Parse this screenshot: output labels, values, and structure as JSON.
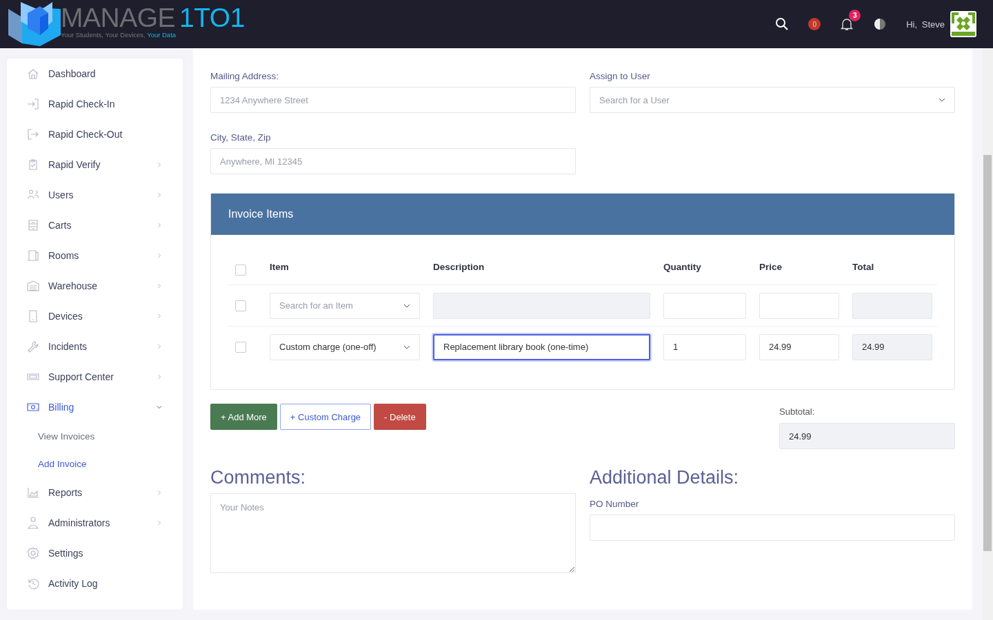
{
  "header": {
    "logo_title": [
      "MANAGE",
      "1TO1"
    ],
    "logo_tagline": [
      "Your Students, Your Devices,",
      "Your Data"
    ],
    "cart_count": "0",
    "notification_count": "3",
    "greeting": "Hi,",
    "user_name": "Steve"
  },
  "sidebar": {
    "items": [
      {
        "label": "Dashboard",
        "has_submenu": false,
        "selected": false
      },
      {
        "label": "Rapid Check-In",
        "has_submenu": false,
        "selected": false
      },
      {
        "label": "Rapid Check-Out",
        "has_submenu": false,
        "selected": false
      },
      {
        "label": "Rapid Verify",
        "has_submenu": true,
        "selected": false,
        "expanded": false
      },
      {
        "label": "Users",
        "has_submenu": true,
        "selected": false,
        "expanded": false
      },
      {
        "label": "Carts",
        "has_submenu": true,
        "selected": false,
        "expanded": false
      },
      {
        "label": "Rooms",
        "has_submenu": true,
        "selected": false,
        "expanded": false
      },
      {
        "label": "Warehouse",
        "has_submenu": true,
        "selected": false,
        "expanded": false
      },
      {
        "label": "Devices",
        "has_submenu": true,
        "selected": false,
        "expanded": false
      },
      {
        "label": "Incidents",
        "has_submenu": true,
        "selected": false,
        "expanded": false
      },
      {
        "label": "Support Center",
        "has_submenu": true,
        "selected": false,
        "expanded": false
      },
      {
        "label": "Billing",
        "has_submenu": true,
        "selected": true,
        "expanded": true,
        "children": [
          {
            "label": "View Invoices",
            "selected": false
          },
          {
            "label": "Add Invoice",
            "selected": true
          }
        ]
      },
      {
        "label": "Reports",
        "has_submenu": true,
        "selected": false,
        "expanded": false
      },
      {
        "label": "Administrators",
        "has_submenu": true,
        "selected": false,
        "expanded": false
      },
      {
        "label": "Settings",
        "has_submenu": false,
        "selected": false
      },
      {
        "label": "Activity Log",
        "has_submenu": false,
        "selected": false
      }
    ]
  },
  "form": {
    "mailing_address": {
      "label": "Mailing Address:",
      "placeholder": "1234 Anywhere Street"
    },
    "assign_user": {
      "label": "Assign to User",
      "placeholder": "Search for a User"
    },
    "city_state_zip": {
      "label": "City, State, Zip",
      "placeholder": "Anywhere, MI 12345"
    }
  },
  "invoice_items": {
    "title": "Invoice Items",
    "columns": [
      "Item",
      "Description",
      "Quantity",
      "Price",
      "Total"
    ],
    "all_checked": false,
    "rows": [
      {
        "checked": false,
        "item_placeholder": "Search for an Item",
        "description_disabled": true,
        "focused": false
      },
      {
        "checked": false,
        "item_value": "Custom charge (one-off)",
        "description": "Replacement library book (one-time)",
        "description_disabled": false,
        "focused": true,
        "quantity": "1",
        "price": "24.99",
        "total": "24.99"
      }
    ]
  },
  "buttons": [
    "+ Add More",
    "+ Custom Charge",
    "- Delete"
  ],
  "subtotal": {
    "label": "Subtotal:",
    "value": "24.99"
  },
  "comments": {
    "heading": "Comments:",
    "placeholder": "Your Notes"
  },
  "additional": {
    "heading": "Additional Details:",
    "po_label": "PO Number"
  }
}
